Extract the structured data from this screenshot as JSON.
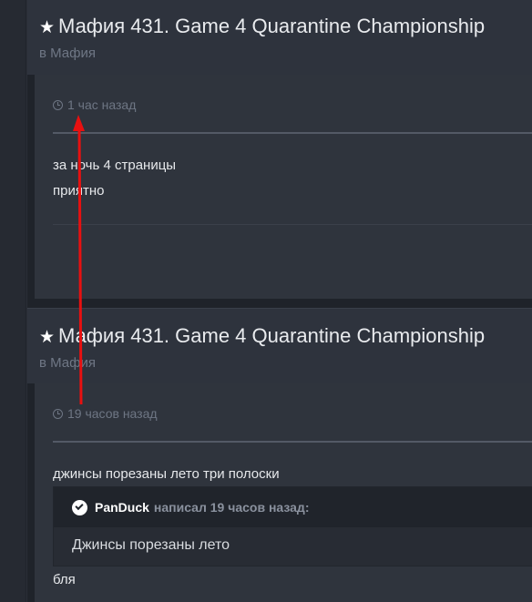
{
  "posts": [
    {
      "title": "Мафия 431. Game 4 Quarantine Championship",
      "forum": "в Мафия",
      "time": "1 час назад",
      "lines": [
        "за ночь 4 страницы",
        "приятно"
      ]
    },
    {
      "title": "Мафия 431. Game 4 Quarantine Championship",
      "forum": "в Мафия",
      "time": "19 часов назад",
      "lines": [
        "джинсы порезаны лето три полоски",
        "бля"
      ],
      "quote": {
        "author": "PanDuck",
        "meta": "написал 19 часов назад:",
        "text": "Джинсы порезаны лето"
      }
    }
  ],
  "colors": {
    "background": "#2b2f38",
    "annotation_arrow": "#e81010"
  }
}
